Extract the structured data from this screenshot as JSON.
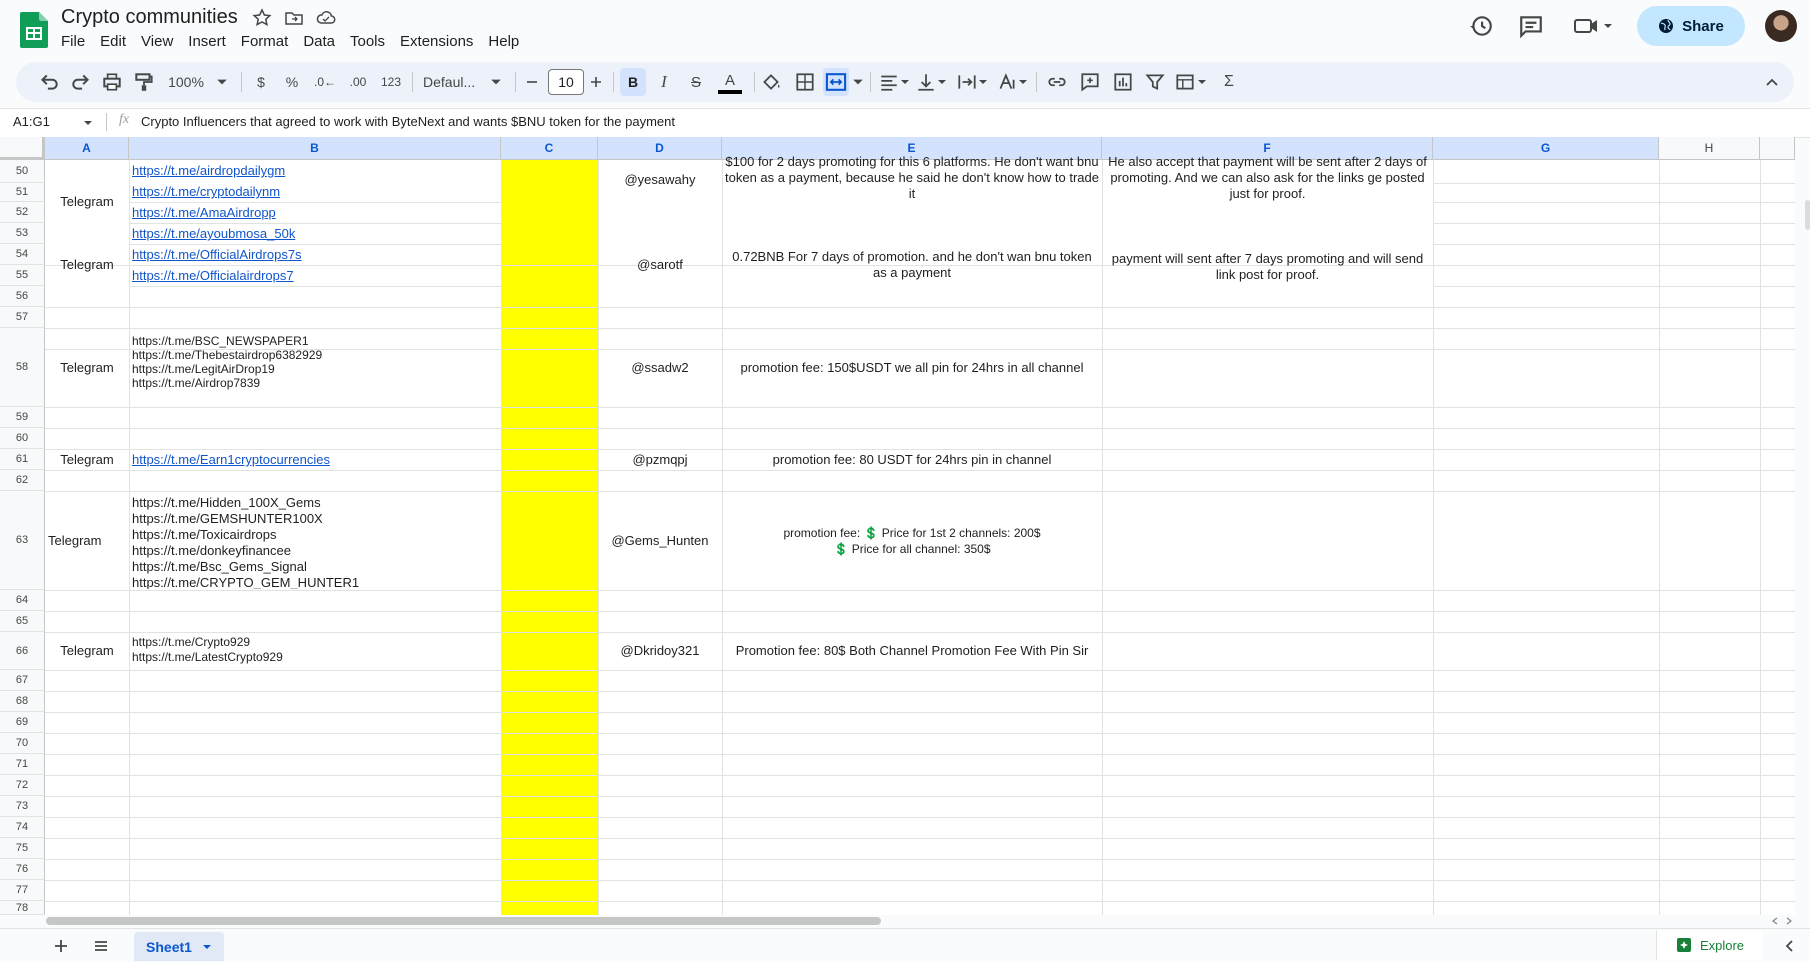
{
  "app": {
    "title": "Crypto communities",
    "menu": [
      "File",
      "Edit",
      "View",
      "Insert",
      "Format",
      "Data",
      "Tools",
      "Extensions",
      "Help"
    ],
    "share_label": "Share"
  },
  "toolbar": {
    "zoom": "100%",
    "currency": "$",
    "percent": "%",
    "dec_decrease": ".0←",
    "dec_increase": ".00",
    "number_format": "123",
    "font": "Defaul...",
    "font_size": "10",
    "bold": "B",
    "italic": "I",
    "strike": "S",
    "text_color_letter": "A",
    "sum": "Σ"
  },
  "formula_bar": {
    "name_box": "A1:G1",
    "fx": "fx",
    "content": "Crypto Influencers that agreed to work with ByteNext and wants $BNU token for the payment"
  },
  "columns": [
    "A",
    "B",
    "C",
    "D",
    "E",
    "F",
    "G",
    "H"
  ],
  "rows": [
    "50",
    "51",
    "52",
    "53",
    "54",
    "55",
    "56",
    "57",
    "58",
    "59",
    "60",
    "61",
    "62",
    "63",
    "64",
    "65",
    "66",
    "67",
    "68",
    "69",
    "70",
    "71",
    "72",
    "73",
    "74",
    "75",
    "76",
    "77",
    "78"
  ],
  "cells": {
    "r50": {
      "a": "Telegram",
      "links": [
        "https://t.me/airdropdailygm",
        "https://t.me/cryptodailynm",
        "https://t.me/AmaAirdropp",
        "https://t.me/ayoubmosa_50k"
      ],
      "d": "@yesawahy",
      "e": "$100 for 2 days promoting for this 6 platforms. He don't want bnu token as a payment, because he said he don't know how to trade it",
      "f": "He also accept that payment will be sent after 2 days of promoting. And we can also ask for the links ge posted just for proof."
    },
    "r54": {
      "a": "Telegram",
      "links": [
        "https://t.me/OfficialAirdrops7s",
        "https://t.me/Officialairdrops7"
      ],
      "d": "@sarotf",
      "e": "0.72BNB For 7 days of promotion. and he don't wan bnu token as a payment",
      "f": "payment will sent after 7 days promoting and will send link post for proof."
    },
    "r58": {
      "a": "Telegram",
      "lines": [
        "https://t.me/BSC_NEWSPAPER1",
        "https://t.me/Thebestairdrop6382929",
        "https://t.me/LegitAirDrop19",
        "https://t.me/Airdrop7839"
      ],
      "d": "@ssadw2",
      "e": "promotion fee: 150$USDT we all pin for 24hrs in all channel"
    },
    "r61": {
      "a": "Telegram",
      "link": "https://t.me/Earn1cryptocurrencies",
      "d": "@pzmqpj",
      "e": "promotion fee: 80 USDT for 24hrs pin in channel"
    },
    "r63": {
      "a": "Telegram",
      "lines": [
        "https://t.me/Hidden_100X_Gems",
        "https://t.me/GEMSHUNTER100X",
        "https://t.me/Toxicairdrops",
        "https://t.me/donkeyfinancee",
        "https://t.me/Bsc_Gems_Signal",
        "https://t.me/CRYPTO_GEM_HUNTER1"
      ],
      "d": "@Gems_Hunten",
      "e1": "promotion fee: 💲 Price for 1st 2 channels: 200$",
      "e2": "💲 Price for all channel: 350$"
    },
    "r66": {
      "a": "Telegram",
      "lines": [
        "https://t.me/Crypto929",
        "https://t.me/LatestCrypto929"
      ],
      "d": "@Dkridoy321",
      "e": "Promotion fee: 80$ Both Channel Promotion Fee With Pin Sir"
    }
  },
  "sheets": {
    "active": "Sheet1",
    "explore_label": "Explore"
  },
  "colors": {
    "highlight_column": "#ffff00",
    "link": "#1155cc",
    "share_bg": "#c2e7ff",
    "sheets_green": "#0f9d58"
  }
}
